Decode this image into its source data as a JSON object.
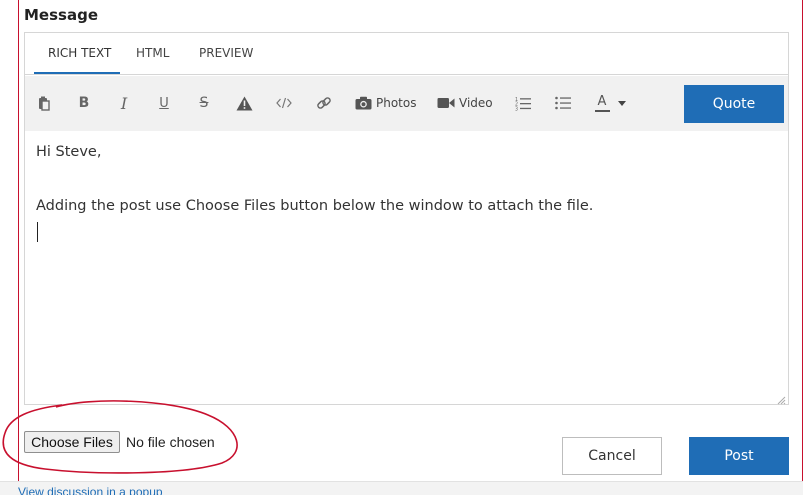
{
  "section": {
    "title": "Message"
  },
  "tabs": [
    {
      "label": "RICH TEXT",
      "active": true
    },
    {
      "label": "HTML",
      "active": false
    },
    {
      "label": "PREVIEW",
      "active": false
    }
  ],
  "toolbar": {
    "items": [
      {
        "name": "paste-icon"
      },
      {
        "name": "bold-icon",
        "glyph": "B"
      },
      {
        "name": "italic-icon",
        "glyph": "I"
      },
      {
        "name": "underline-icon",
        "glyph": "U"
      },
      {
        "name": "strikethrough-icon",
        "glyph": "S"
      },
      {
        "name": "warning-icon"
      },
      {
        "name": "code-icon"
      },
      {
        "name": "link-icon"
      },
      {
        "name": "camera-icon",
        "label": "Photos"
      },
      {
        "name": "video-icon",
        "label": "Video"
      },
      {
        "name": "numbered-list-icon"
      },
      {
        "name": "bulleted-list-icon"
      },
      {
        "name": "font-color-icon",
        "glyph": "A"
      }
    ],
    "quote_label": "Quote"
  },
  "editor": {
    "line1": "Hi Steve,",
    "line2": "Adding the post use Choose Files button below the window to attach the file."
  },
  "file_input": {
    "button_label": "Choose Files",
    "status": "No file chosen"
  },
  "actions": {
    "cancel_label": "Cancel",
    "post_label": "Post"
  },
  "footer": {
    "link_text": "View discussion in a popup"
  },
  "colors": {
    "accent": "#1f6db6",
    "annotation_red": "#c8102e",
    "toolbar_bg": "#f1f1f1"
  }
}
